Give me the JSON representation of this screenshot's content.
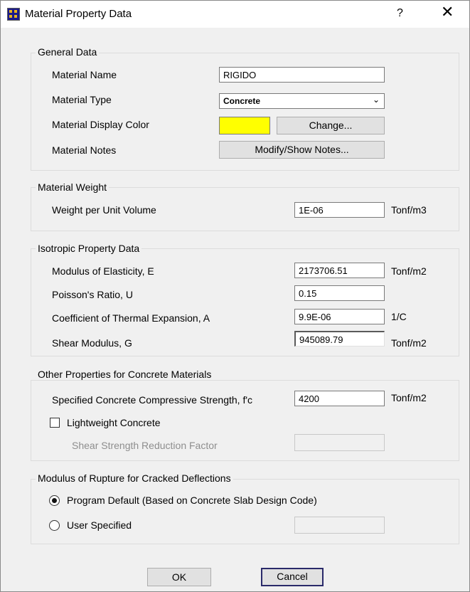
{
  "window": {
    "title": "Material Property Data",
    "help_label": "?",
    "close_label": "✕"
  },
  "general": {
    "group_title": "General Data",
    "name_label": "Material Name",
    "name_value": "RIGIDO",
    "type_label": "Material Type",
    "type_value": "Concrete",
    "color_label": "Material Display Color",
    "color_value": "#ffff00",
    "change_button": "Change...",
    "notes_label": "Material Notes",
    "notes_button": "Modify/Show Notes..."
  },
  "weight": {
    "group_title": "Material Weight",
    "weight_label": "Weight per Unit Volume",
    "weight_value": "1E-06",
    "weight_unit": "Tonf/m3"
  },
  "isotropic": {
    "group_title": "Isotropic Property Data",
    "e_label": "Modulus of Elasticity,  E",
    "e_value": "2173706.51",
    "e_unit": "Tonf/m2",
    "u_label": "Poisson's Ratio,  U",
    "u_value": "0.15",
    "a_label": "Coefficient of Thermal Expansion,  A",
    "a_value": "9.9E-06",
    "a_unit": "1/C",
    "g_label": "Shear Modulus,  G",
    "g_value": "945089.79",
    "g_unit": "Tonf/m2"
  },
  "concrete": {
    "group_title": "Other Properties for Concrete Materials",
    "fc_label": "Specified Concrete Compressive Strength, f'c",
    "fc_value": "4200",
    "fc_unit": "Tonf/m2",
    "lightweight_label": "Lightweight Concrete",
    "lightweight_checked": false,
    "shear_factor_label": "Shear Strength Reduction Factor",
    "shear_factor_value": ""
  },
  "rupture": {
    "group_title": "Modulus of Rupture for Cracked Deflections",
    "default_label": "Program Default  (Based on Concrete Slab Design Code)",
    "user_label": "User Specified",
    "selected": "default",
    "user_value": ""
  },
  "buttons": {
    "ok": "OK",
    "cancel": "Cancel"
  }
}
